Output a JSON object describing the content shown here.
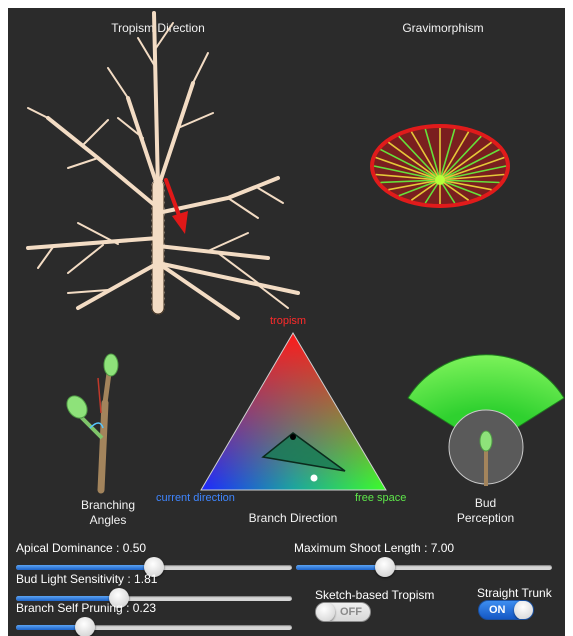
{
  "panels": {
    "tropism_direction": "Tropism Direction",
    "gravimorphism": "Gravimorphism",
    "branching_angles": "Branching\nAngles",
    "branch_direction": "Branch Direction",
    "bud_perception": "Bud\nPerception"
  },
  "triangle": {
    "top_label": "tropism",
    "left_label": "current direction",
    "right_label": "free space"
  },
  "sliders": [
    {
      "label": "Apical Dominance : 0.50",
      "value": 0.5,
      "min": 0,
      "max": 1
    },
    {
      "label": "Bud Light Sensitivity : 1.81",
      "value": 1.81,
      "min": 0,
      "max": 5
    },
    {
      "label": "Branch Self Pruning : 0.23",
      "value": 0.23,
      "min": 0,
      "max": 1
    },
    {
      "label": "Maximum Shoot Length : 7.00",
      "value": 7.0,
      "min": 0,
      "max": 21
    }
  ],
  "toggles": {
    "sketch_tropism": {
      "label": "Sketch-based Tropism",
      "state": "OFF"
    },
    "straight_trunk": {
      "label": "Straight Trunk",
      "state": "ON"
    }
  },
  "colors": {
    "background": "#2b2b2b",
    "tropism_red": "#ff2a2a",
    "current_blue": "#3f86ff",
    "free_green": "#5ee64a"
  },
  "icons": {
    "tree": "tree-icon",
    "arrow": "tropism-arrow-icon",
    "ellipse": "gravimorphism-icon",
    "sprout": "sprout-icon",
    "bud": "bud-icon"
  }
}
